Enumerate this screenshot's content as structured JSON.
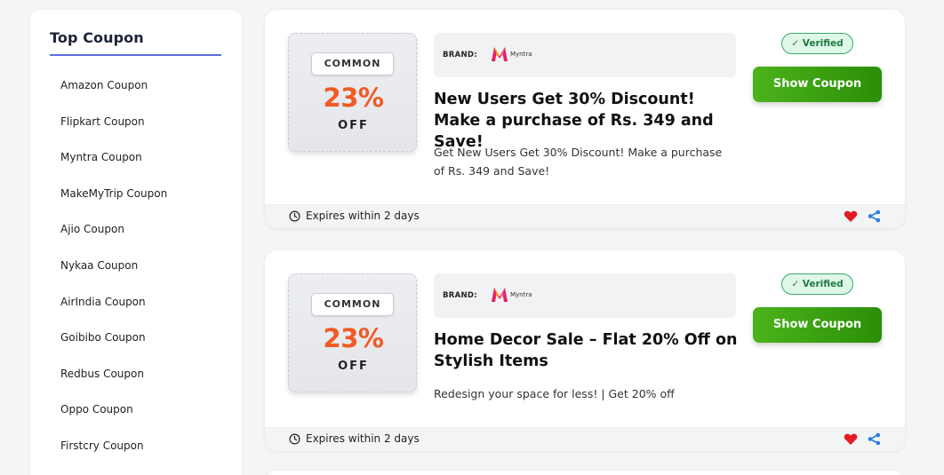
{
  "sidebar": {
    "title": "Top Coupon",
    "items": [
      {
        "label": "Amazon Coupon"
      },
      {
        "label": "Flipkart Coupon"
      },
      {
        "label": "Myntra Coupon"
      },
      {
        "label": "MakeMyTrip Coupon"
      },
      {
        "label": "Ajio Coupon"
      },
      {
        "label": "Nykaa Coupon"
      },
      {
        "label": "AirIndia Coupon"
      },
      {
        "label": "Goibibo Coupon"
      },
      {
        "label": "Redbus Coupon"
      },
      {
        "label": "Oppo Coupon"
      },
      {
        "label": "Firstcry Coupon"
      }
    ]
  },
  "coupons": [
    {
      "tag": "COMMON",
      "discount": "23%",
      "off": "OFF",
      "brand_label": "BRAND:",
      "brand_name": "Myntra",
      "title": "New Users Get 30% Discount! Make a purchase of Rs. 349 and Save!",
      "description": "Get New Users Get 30% Discount! Make a purchase of Rs. 349 and Save!",
      "verified": "✓ Verified",
      "button": "Show Coupon",
      "expires": "Expires within 2 days"
    },
    {
      "tag": "COMMON",
      "discount": "23%",
      "off": "OFF",
      "brand_label": "BRAND:",
      "brand_name": "Myntra",
      "title": "Home Decor Sale – Flat 20% Off on Stylish Items",
      "description": "Redesign your space for less! | Get 20% off",
      "verified": "✓ Verified",
      "button": "Show Coupon",
      "expires": "Expires within 2 days"
    }
  ],
  "colors": {
    "accent_underline": "#5b6fe0",
    "discount_orange": "#f15a24",
    "button_green": "#2b8f07",
    "verified_green": "#1f7a3f",
    "heart_red": "#e31b23",
    "share_blue": "#2a7de1"
  },
  "icons": {
    "clock": "clock-icon",
    "heart": "heart-icon",
    "share": "share-icon",
    "brand_logo": "myntra-logo-icon"
  }
}
